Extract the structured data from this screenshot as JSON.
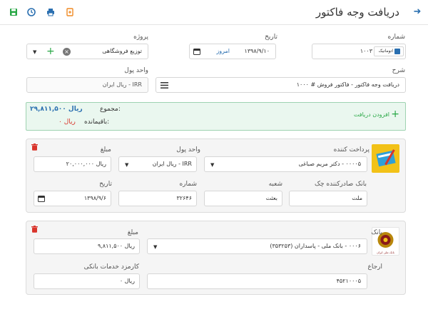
{
  "header": {
    "title": "دریافت وجه فاکتور"
  },
  "form": {
    "number_label": "شماره",
    "number_value": "۱۰۰۳",
    "auto_label": "اتوماتیک",
    "date_label": "تاریخ",
    "date_value": "۱۳۹۸/۹/۱۰",
    "today_label": "امروز",
    "project_label": "پروژه",
    "project_value": "توزیع فروشگاهی",
    "description_label": "شرح",
    "description_value": "دریافت وجه فاکتور - فاکتور فروش # ۱۰۰۰",
    "currency_label": "واحد پول",
    "currency_value": "IRR - ریال ایران"
  },
  "summary": {
    "add_label": "افزودن دریافت",
    "total_label": "مجموع:",
    "total_value": "ریال ۲۹,۸۱۱,۵۰۰",
    "remaining_label": "باقیمانده:",
    "remaining_value": "ریال ۰"
  },
  "payer_card": {
    "payer_label": "پرداخت کننده",
    "payer_value": "۰۰۰۰۵ - دکتر مریم صباغی",
    "currency_label": "واحد پول",
    "currency_value": "IRR - ریال ایران",
    "amount_label": "مبلغ",
    "amount_value": "ریال ۲۰,۰۰۰,۰۰۰",
    "issuer_bank_label": "بانک صادرکننده چک",
    "issuer_bank_value": "ملت",
    "branch_label": "شعبه",
    "branch_value": "بعثت",
    "check_number_label": "شماره",
    "check_number_value": "۳۲۶۴۶",
    "date_label": "تاریخ",
    "date_value": "۱۳۹۸/۹/۶"
  },
  "bank_card": {
    "bank_label": "بانک",
    "bank_value": "۰۰۰۶ - بانک ملی - پاسداران (۳۵۳۲۵۳)",
    "amount_label": "مبلغ",
    "amount_value": "ریال ۹,۸۱۱,۵۰۰",
    "reference_label": "ارجاع",
    "reference_value": "۴۵۲۱۰۰۰۵",
    "fee_label": "کارمزد خدمات بانکی",
    "fee_value": "ریال ۰",
    "logo_caption": "بانک ملی ایران"
  },
  "colors": {
    "accent": "#2a6fb0",
    "add_green": "#28a745",
    "danger": "#d9342b",
    "success_border": "#9ed3b1",
    "success_bg": "#eaf7ef"
  }
}
